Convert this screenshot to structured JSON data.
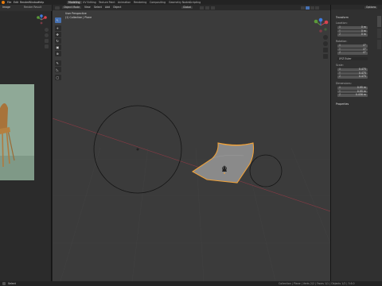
{
  "app": {
    "accent": "#4772b3",
    "select_color": "#f0a23a"
  },
  "top_menu": {
    "items": [
      "File",
      "Edit",
      "Render",
      "Window",
      "Help"
    ],
    "workspaces": [
      "Modeling",
      "UV Editing",
      "Texture Paint",
      "Animation",
      "Rendering",
      "Compositing",
      "Geometry Nodes",
      "Scripting"
    ]
  },
  "left_panel": {
    "header_label": "Image",
    "view_label": "Render Result"
  },
  "viewport": {
    "mode": "Object Mode",
    "menus": [
      "View",
      "Select",
      "Add",
      "Object"
    ],
    "info_line1": "User Perspective",
    "info_line2": "(1) Collection | Plane",
    "orientation": "Global",
    "options_label": "Options",
    "tools": [
      "select-tool",
      "cursor-tool",
      "move-tool",
      "rotate-tool",
      "scale-tool",
      "transform-tool",
      "annotate-tool",
      "measure-tool",
      "add-cube-tool"
    ]
  },
  "properties": {
    "transform_title": "Transform",
    "location_title": "Location:",
    "rotation_title": "Rotation:",
    "scale_title": "Scale:",
    "dimensions_title": "Dimensions:",
    "rotation_mode": "XYZ Euler",
    "location": [
      {
        "axis": "X",
        "value": "0 m"
      },
      {
        "axis": "Y",
        "value": "0 m"
      },
      {
        "axis": "Z",
        "value": "0 m"
      }
    ],
    "rotation": [
      {
        "axis": "X",
        "value": "0°"
      },
      {
        "axis": "Y",
        "value": "0°"
      },
      {
        "axis": "Z",
        "value": "0°"
      }
    ],
    "scale": [
      {
        "axis": "X",
        "value": "0.475"
      },
      {
        "axis": "Y",
        "value": "0.475"
      },
      {
        "axis": "Z",
        "value": "0.475"
      }
    ],
    "dimensions": [
      {
        "axis": "X",
        "value": "0.95 m"
      },
      {
        "axis": "Y",
        "value": "0.95 m"
      },
      {
        "axis": "Z",
        "value": "0.456 m"
      }
    ],
    "properties_title": "Properties"
  },
  "statusbar": {
    "left": "Select",
    "right": "Collection | Plane | Verts 2/2 | Faces 1/1 | Objects 1/2 | 3.6.0"
  }
}
